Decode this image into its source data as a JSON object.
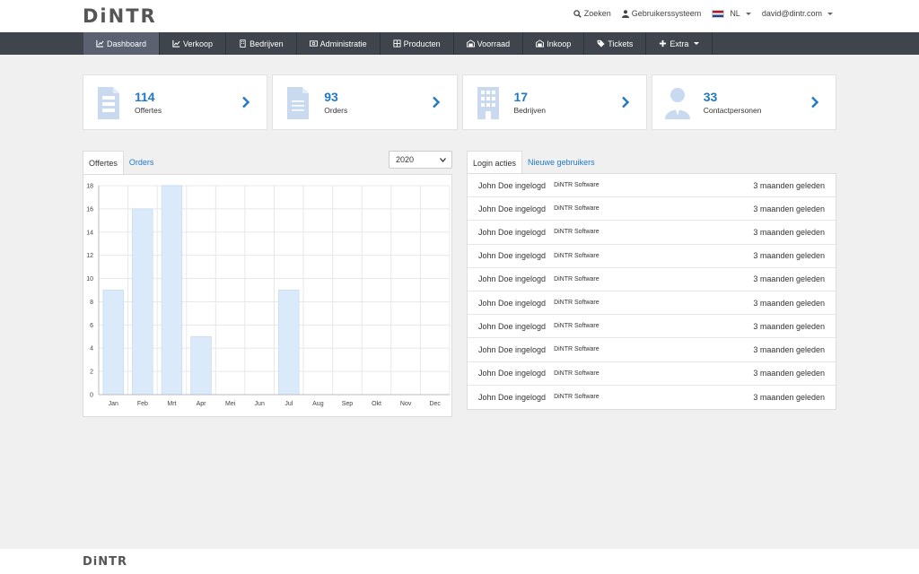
{
  "header": {
    "logo": "DiNTR",
    "search_label": "Zoeken",
    "system_label": "Gebruikerssysteem",
    "language": "NL",
    "user_email": "david@dintr.com"
  },
  "nav": {
    "items": [
      {
        "label": "Dashboard",
        "icon": "chart-icon",
        "active": true
      },
      {
        "label": "Verkoop",
        "icon": "line-chart-icon",
        "active": false
      },
      {
        "label": "Bedrijven",
        "icon": "building-icon",
        "active": false
      },
      {
        "label": "Administratie",
        "icon": "money-icon",
        "active": false
      },
      {
        "label": "Producten",
        "icon": "grid-icon",
        "active": false
      },
      {
        "label": "Voorraad",
        "icon": "warehouse-icon",
        "active": false
      },
      {
        "label": "Inkoop",
        "icon": "truck-icon",
        "active": false
      },
      {
        "label": "Tickets",
        "icon": "tag-icon",
        "active": false
      },
      {
        "label": "Extra",
        "icon": "plus-icon",
        "active": false
      }
    ]
  },
  "stats": [
    {
      "value": "114",
      "label": "Offertes",
      "icon": "document-icon"
    },
    {
      "value": "93",
      "label": "Orders",
      "icon": "file-icon"
    },
    {
      "value": "17",
      "label": "Bedrijven",
      "icon": "building-icon"
    },
    {
      "value": "33",
      "label": "Contactpersonen",
      "icon": "person-icon"
    }
  ],
  "chart_panel": {
    "tabs": [
      "Offertes",
      "Orders"
    ],
    "active_tab": "Offertes",
    "year": "2020"
  },
  "chart_data": {
    "type": "bar",
    "categories": [
      "Jan",
      "Feb",
      "Mrt",
      "Apr",
      "Mei",
      "Jun",
      "Jul",
      "Aug",
      "Sep",
      "Okt",
      "Nov",
      "Dec"
    ],
    "values": [
      9,
      16,
      18,
      5,
      0,
      0,
      9,
      0,
      0,
      0,
      0,
      0
    ],
    "ylim": [
      0,
      18
    ],
    "yticks": [
      0,
      2,
      4,
      6,
      8,
      10,
      12,
      14,
      16,
      18
    ],
    "grid": true,
    "bar_color": "#dbeafb",
    "bar_stroke": "#c4dcf5"
  },
  "activity_panel": {
    "tabs": [
      "Login acties",
      "Nieuwe gebruikers"
    ],
    "active_tab": "Login acties",
    "items": [
      {
        "user": "John Doe ingelogd",
        "company": "DiNTR Software",
        "time": "3 maanden geleden"
      },
      {
        "user": "John Doe ingelogd",
        "company": "DiNTR Software",
        "time": "3 maanden geleden"
      },
      {
        "user": "John Doe ingelogd",
        "company": "DiNTR Software",
        "time": "3 maanden geleden"
      },
      {
        "user": "John Doe ingelogd",
        "company": "DiNTR Software",
        "time": "3 maanden geleden"
      },
      {
        "user": "John Doe ingelogd",
        "company": "DiNTR Software",
        "time": "3 maanden geleden"
      },
      {
        "user": "John Doe ingelogd",
        "company": "DiNTR Software",
        "time": "3 maanden geleden"
      },
      {
        "user": "John Doe ingelogd",
        "company": "DiNTR Software",
        "time": "3 maanden geleden"
      },
      {
        "user": "John Doe ingelogd",
        "company": "DiNTR Software",
        "time": "3 maanden geleden"
      },
      {
        "user": "John Doe ingelogd",
        "company": "DiNTR Software",
        "time": "3 maanden geleden"
      },
      {
        "user": "John Doe ingelogd",
        "company": "DiNTR Software",
        "time": "3 maanden geleden"
      }
    ]
  },
  "footer": {
    "logo": "DiNTR"
  },
  "colors": {
    "accent": "#1f78c8",
    "navbar": "#40444d",
    "nav_active": "#5b6170",
    "icon_muted": "#c9daf0"
  }
}
